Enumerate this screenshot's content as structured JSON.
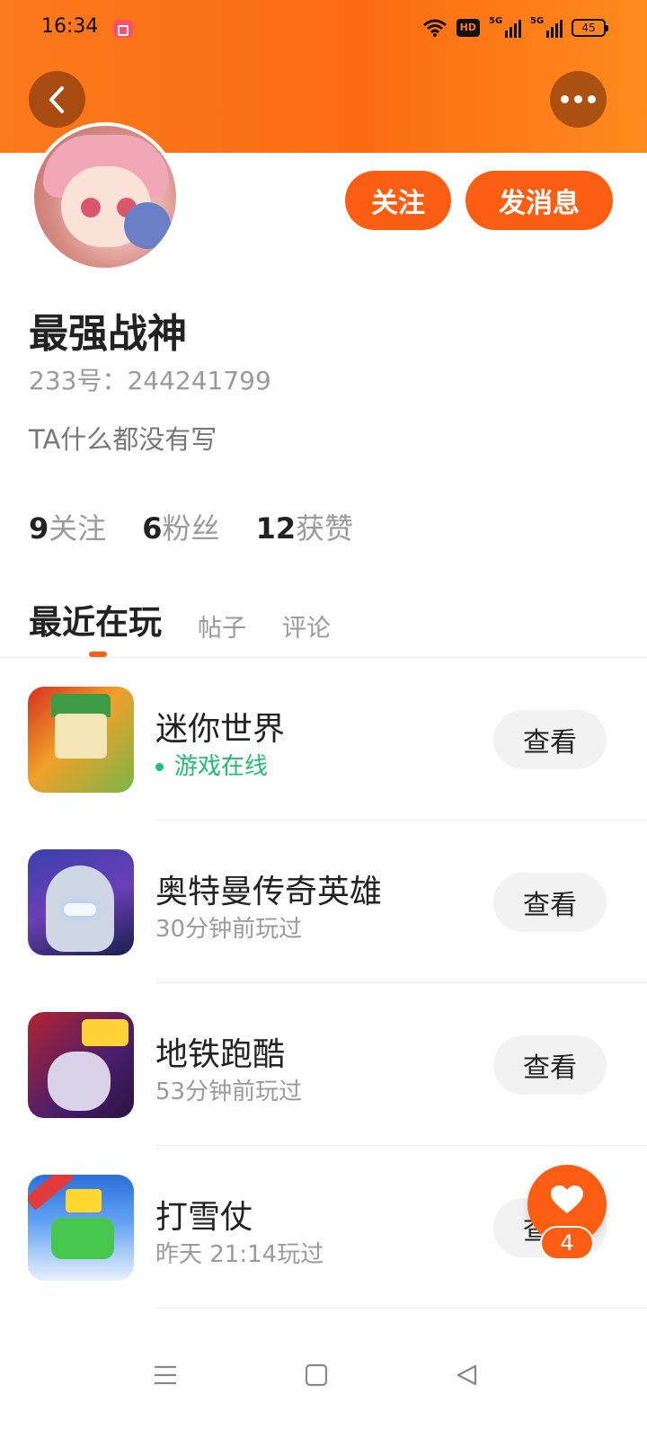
{
  "status_bar": {
    "time": "16:34",
    "hd_label": "HD",
    "sig1_label": "5G",
    "sig2_label": "5G",
    "battery": "45"
  },
  "header": {
    "back_icon": "chevron-left-icon",
    "more_icon": "more-dots-icon"
  },
  "profile": {
    "name": "最强战神",
    "id_text": "233号：244241799",
    "bio": "TA什么都没有写",
    "follow_label": "关注",
    "message_label": "发消息",
    "stats": [
      {
        "num": "9",
        "label": "关注"
      },
      {
        "num": "6",
        "label": "粉丝"
      },
      {
        "num": "12",
        "label": "获赞"
      }
    ]
  },
  "tabs": [
    {
      "label": "最近在玩",
      "active": true
    },
    {
      "label": "帖子",
      "active": false
    },
    {
      "label": "评论",
      "active": false
    }
  ],
  "games": [
    {
      "title": "迷你世界",
      "subtitle": "游戏在线",
      "online": true,
      "button": "查看"
    },
    {
      "title": "奥特曼传奇英雄",
      "subtitle": "30分钟前玩过",
      "online": false,
      "button": "查看"
    },
    {
      "title": "地铁跑酷",
      "subtitle": "53分钟前玩过",
      "online": false,
      "button": "查看"
    },
    {
      "title": "打雪仗",
      "subtitle": "昨天 21:14玩过",
      "online": false,
      "button": "查看"
    }
  ],
  "float_like": {
    "icon": "heart-icon",
    "count": "4"
  },
  "colors": {
    "accent": "#fb5d13",
    "online_green": "#1fbf6f"
  }
}
